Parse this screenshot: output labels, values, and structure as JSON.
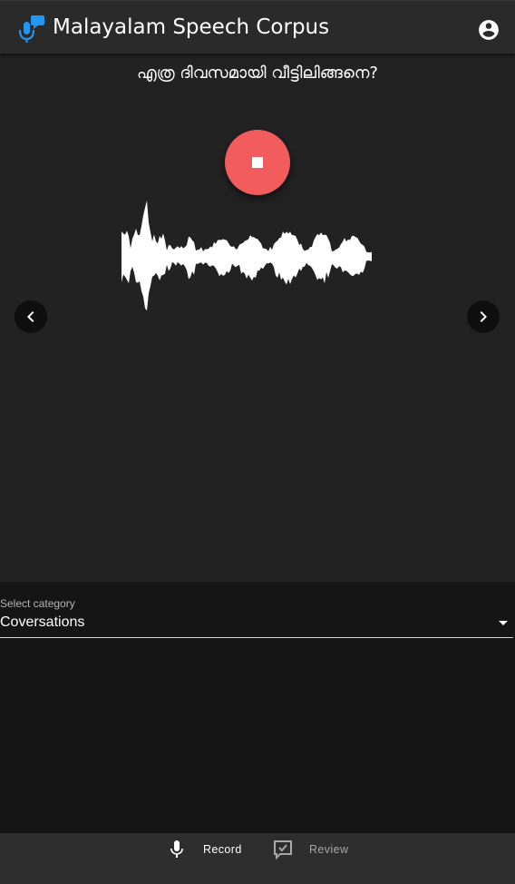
{
  "app": {
    "title": "Malayalam Speech Corpus",
    "logo_icon": "mic-chat-logo-icon",
    "account_icon": "account-circle-icon"
  },
  "recorder": {
    "prompt": "എത്ര ദിവസമായി വീട്ടിലിങ്ങനെ?",
    "stop_icon": "stop-icon",
    "stop_color": "#f25c5c",
    "prev_icon": "chevron-left-icon",
    "next_icon": "chevron-right-icon"
  },
  "category": {
    "label": "Select category",
    "value": "Coversations",
    "dropdown_icon": "arrow-drop-down-icon"
  },
  "bottom_nav": {
    "items": [
      {
        "label": "Record",
        "icon": "mic-icon",
        "active": true
      },
      {
        "label": "Review",
        "icon": "rate-review-icon",
        "active": false
      }
    ]
  },
  "colors": {
    "brand_blue": "#2196f3",
    "appbar": "#2a2a2a",
    "content_bg": "#222222"
  }
}
